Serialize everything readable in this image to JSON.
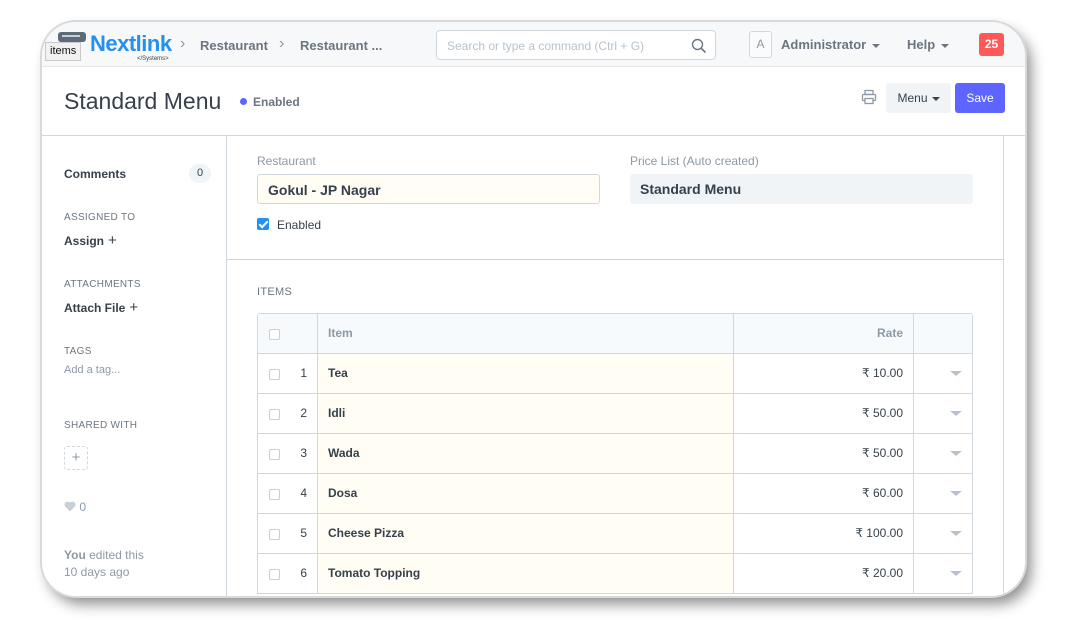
{
  "tooltip": "items",
  "logo": {
    "name": "Nextlink",
    "tagline": "</Systems>"
  },
  "breadcrumbs": [
    "Restaurant",
    "Restaurant ..."
  ],
  "search": {
    "placeholder": "Search or type a command (Ctrl + G)"
  },
  "user": {
    "avatar_letter": "A",
    "name": "Administrator"
  },
  "help_label": "Help",
  "notifications_count": "25",
  "page": {
    "title": "Standard Menu",
    "status": "Enabled"
  },
  "actions": {
    "menu_label": "Menu",
    "save_label": "Save"
  },
  "sidebar": {
    "comments_label": "Comments",
    "comments_count": "0",
    "assigned_heading": "ASSIGNED TO",
    "assign_label": "Assign",
    "attachments_heading": "ATTACHMENTS",
    "attach_label": "Attach File",
    "tags_heading": "TAGS",
    "tag_placeholder": "Add a tag...",
    "shared_heading": "SHARED WITH",
    "likes_count": "0",
    "edit_user": "You",
    "edit_text": " edited this",
    "edit_time": "10 days ago"
  },
  "form": {
    "restaurant_label": "Restaurant",
    "restaurant_value": "Gokul - JP Nagar",
    "price_list_label": "Price List (Auto created)",
    "price_list_value": "Standard Menu",
    "enabled_label": "Enabled",
    "enabled": true
  },
  "items": {
    "heading": "ITEMS",
    "columns": {
      "item": "Item",
      "rate": "Rate"
    },
    "rows": [
      {
        "no": "1",
        "item": "Tea",
        "rate": "₹ 10.00"
      },
      {
        "no": "2",
        "item": "Idli",
        "rate": "₹ 50.00"
      },
      {
        "no": "3",
        "item": "Wada",
        "rate": "₹ 50.00"
      },
      {
        "no": "4",
        "item": "Dosa",
        "rate": "₹ 60.00"
      },
      {
        "no": "5",
        "item": "Cheese Pizza",
        "rate": "₹ 100.00"
      },
      {
        "no": "6",
        "item": "Tomato Topping",
        "rate": "₹ 20.00"
      }
    ]
  },
  "colors": {
    "accent": "#5e64ff",
    "brand": "#2490ef",
    "badge": "#ff5858",
    "field_bg": "#fffdf4"
  }
}
